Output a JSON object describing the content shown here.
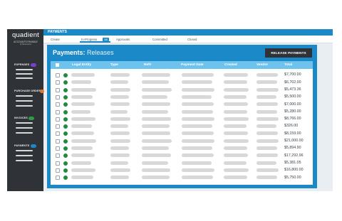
{
  "brand": {
    "name": "quadient",
    "tagline": "ACCOUNTS PAYABLE",
    "byline": "by Beanworks"
  },
  "sidebar": {
    "sections": [
      {
        "label": "EXPENSES",
        "color": "#7b3fd0"
      },
      {
        "label": "PURCHASE ORDERS",
        "color": "#e07a2e"
      },
      {
        "label": "INVOICES",
        "color": "#2e9a48"
      },
      {
        "label": "PAYMENTS",
        "color": "#1b88c7"
      }
    ]
  },
  "header": {
    "section_title": "PAYMENTS"
  },
  "tabs": [
    {
      "label": "Create"
    },
    {
      "label": "In-Progress",
      "badge": "13"
    },
    {
      "label": "Approvals"
    },
    {
      "label": "Committed"
    },
    {
      "label": "Closed"
    }
  ],
  "page": {
    "title_bold": "Payments:",
    "title_rest": "Releases"
  },
  "actions": {
    "release_payments": "RELEASE PAYMENTS"
  },
  "table": {
    "columns": [
      "Legal Entity",
      "Type",
      "Ref#",
      "Payment Date",
      "Created",
      "Vendor",
      "Total"
    ],
    "totals": [
      "$7,700.00",
      "$6,702.00",
      "$5,473.36",
      "$5,500.00",
      "$7,000.00",
      "$5,280.00",
      "$8,766.00",
      "$326.00",
      "$8,159.00",
      "$21,000.00",
      "$5,894.90",
      "$17,292.96",
      "$5,381.05",
      "$16,800.00",
      "$5,750.00"
    ],
    "status_color": "#1f8b3b"
  },
  "colors": {
    "accent": "#1b88c7",
    "sidebar": "#2f3237",
    "header_row": "#6ec3ee"
  }
}
